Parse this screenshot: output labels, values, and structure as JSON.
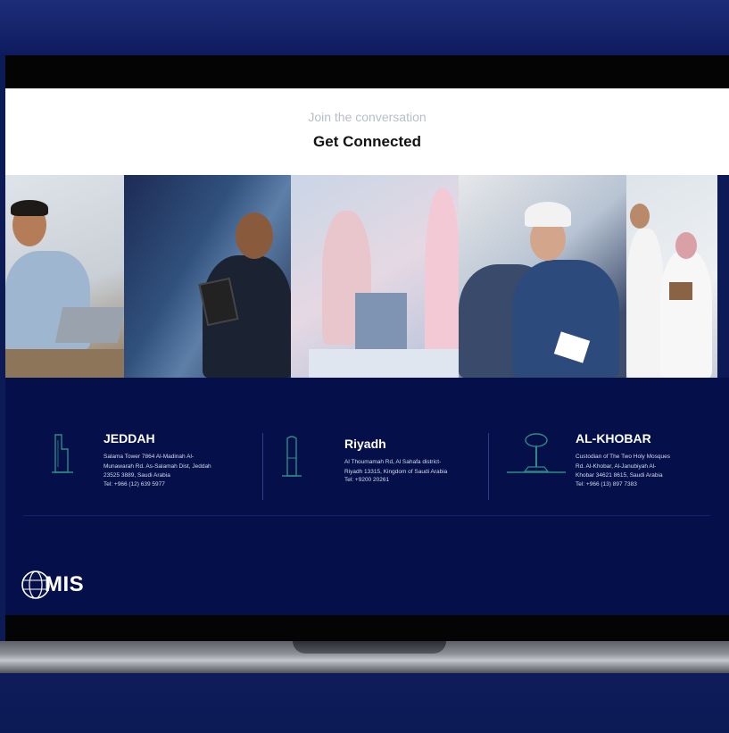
{
  "hero": {
    "eyebrow": "Join the conversation",
    "heading": "Get Connected"
  },
  "offices": [
    {
      "city": "JEDDAH",
      "address": "Salama Tower 7864 Al-Madinah Al-\nMunawarah Rd. As-Salamah Dist, Jeddah\n23525 3889, Saudi Arabia",
      "tel": "Tel: +966 (12) 639 5977",
      "icon": "tower-icon"
    },
    {
      "city": "Riyadh",
      "address": "Al Thoumamah Rd, Al Sahafa district-\nRiyadh 13315, Kingdom of Saudi Arabia",
      "tel": "Tel: +9200 20261",
      "icon": "skyscraper-icon"
    },
    {
      "city": "AL-KHOBAR",
      "address": "Custodian of The Two Holy Mosques\nRd. Al-Khobar, Al-Janubiyah Al-\nKhobar 34621 8615, Saudi Arabia",
      "tel": "Tel: +966 (13) 897 7383",
      "icon": "water-tower-icon"
    }
  ],
  "brand": {
    "logo_text": "MIS",
    "logo_icon": "globe-icon"
  },
  "colors": {
    "footer_bg": "#050f4a",
    "hero_bg": "#ffffff",
    "accent_line": "#2e3d85"
  }
}
